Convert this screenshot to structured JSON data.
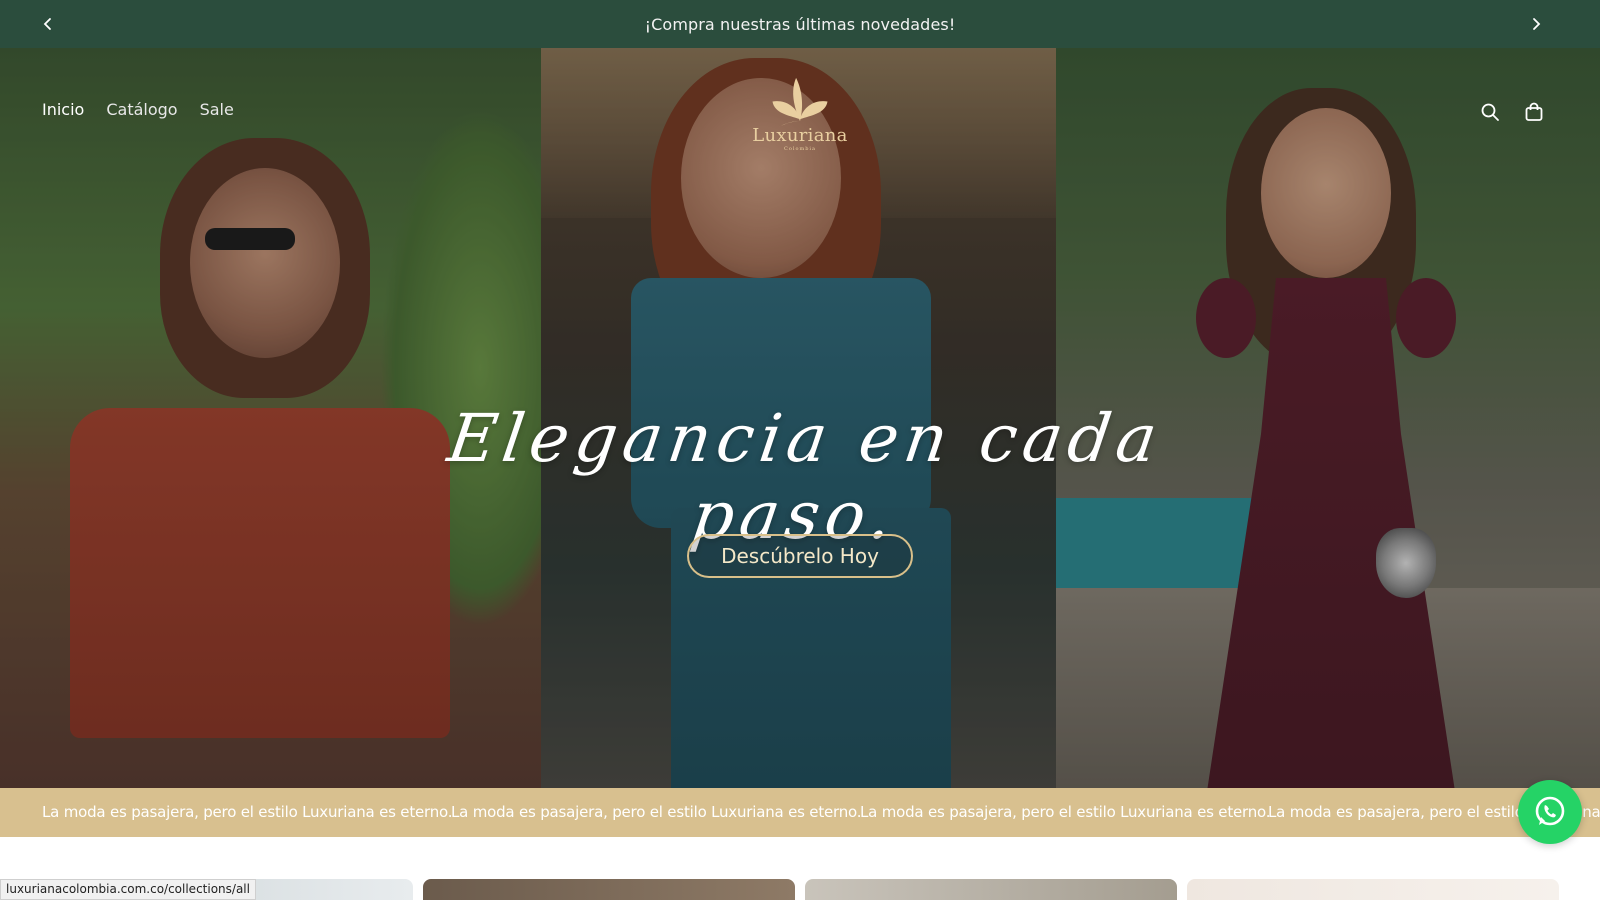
{
  "announcement": {
    "text": "¡Compra nuestras últimas novedades!",
    "prev_icon": "chevron-left-icon",
    "next_icon": "chevron-right-icon"
  },
  "header": {
    "nav": [
      {
        "label": "Inicio",
        "active": true
      },
      {
        "label": "Catálogo",
        "active": false
      },
      {
        "label": "Sale",
        "active": false
      }
    ],
    "logo": {
      "name": "Luxuriana",
      "sub": "Colombia"
    },
    "icons": [
      "search-icon",
      "cart-icon"
    ]
  },
  "hero": {
    "tagline": "Elegancia en cada paso.",
    "cta_label": "Descúbrelo Hoy"
  },
  "marquee": {
    "text": "La moda es pasajera, pero el estilo Luxuriana es eterno.",
    "repeats": 4
  },
  "status_bar": {
    "url": "luxurianacolombia.com.co/collections/all"
  },
  "colors": {
    "announcement_bg": "#2b4d3d",
    "marquee_bg": "#d8c08f",
    "whatsapp": "#25d366",
    "cta_border": "#d9c08a"
  }
}
